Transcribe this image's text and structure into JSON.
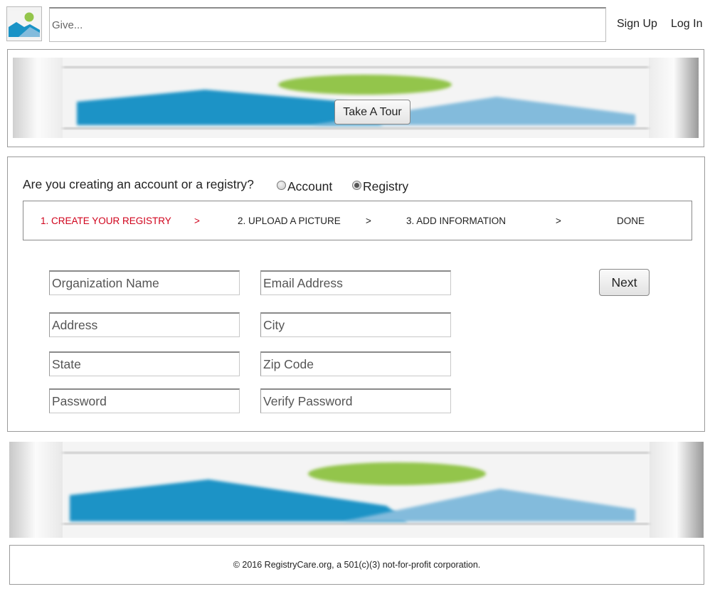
{
  "header": {
    "logo_icon": "image-placeholder-icon",
    "search_placeholder": "Give...",
    "signup_label": "Sign Up",
    "login_label": "Log In"
  },
  "banner": {
    "image_icon": "image-placeholder-icon",
    "tour_label": "Take A Tour"
  },
  "form": {
    "question": "Are you creating an account or a registry?",
    "options": [
      {
        "label": "Account",
        "checked": false
      },
      {
        "label": "Registry",
        "checked": true
      }
    ],
    "steps": [
      {
        "label": "1. CREATE YOUR REGISTRY",
        "active": true
      },
      {
        "label": "2. UPLOAD A PICTURE",
        "active": false
      },
      {
        "label": "3. ADD INFORMATION",
        "active": false
      },
      {
        "label": "DONE",
        "active": false
      }
    ],
    "separator": ">",
    "fields": {
      "org_name": "Organization Name",
      "email": "Email Address",
      "address": "Address",
      "city": "City",
      "state": "State",
      "zip": "Zip Code",
      "password": "Password",
      "verify_password": "Verify Password"
    },
    "next_label": "Next"
  },
  "footer": {
    "text": "© 2016 RegistryCare.org, a 501(c)(3) not-for-profit corporation."
  },
  "colors": {
    "active_step": "#d0021b",
    "image_blue": "#1a93c6",
    "image_light_blue": "#83bbdc",
    "image_green": "#93c54b"
  }
}
